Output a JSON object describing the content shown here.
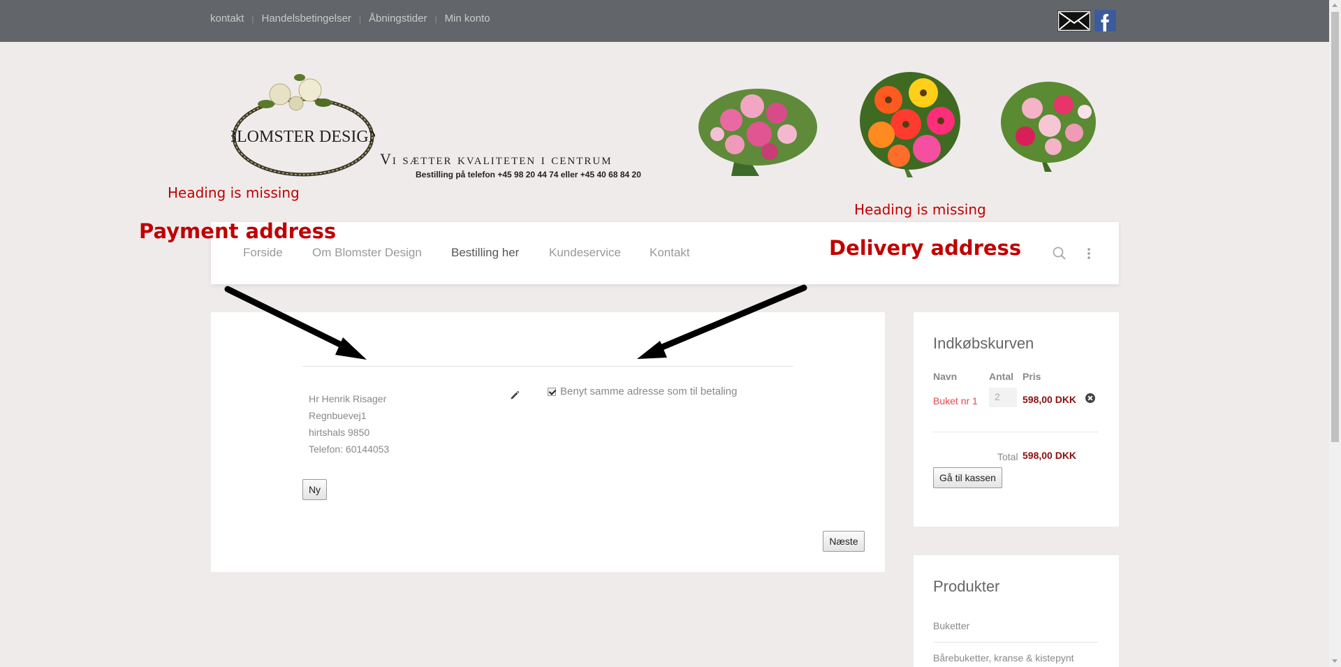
{
  "topbar": {
    "links": [
      "kontakt",
      "Handelsbetingelser",
      "Åbningstider",
      "Min konto"
    ],
    "icons": [
      "mail-icon",
      "facebook-icon"
    ]
  },
  "header": {
    "logo_text": "Blomster Design",
    "tagline": "Vi sætter kvaliteten i centrum",
    "phone": "Bestilling på telefon +45 98 20 44 74 eller +45 40 68 84 20"
  },
  "annotations": {
    "heading_missing_left": "Heading is missing",
    "heading_missing_right": "Heading is missing",
    "payment_address": "Payment address",
    "delivery_address": "Delivery address"
  },
  "nav": {
    "items": [
      "Forside",
      "Om Blomster Design",
      "Bestilling her",
      "Kundeservice",
      "Kontakt"
    ],
    "active": "Bestilling her"
  },
  "address": {
    "name": "Hr Henrik Risager",
    "street": "Regnbuevej1",
    "city": "hirtshals 9850",
    "phone": "Telefon: 60144053"
  },
  "delivery": {
    "same_address_label": "Benyt samme adresse som til betaling",
    "same_address_checked": true
  },
  "buttons": {
    "new": "Ny",
    "next": "Næste",
    "checkout": "Gå til kassen"
  },
  "cart": {
    "title": "Indkøbskurven",
    "headers": [
      "Navn",
      "Antal",
      "Pris"
    ],
    "item_name": "Buket nr 1",
    "item_qty": "2",
    "item_price": "598,00 DKK",
    "total_label": "Total",
    "total_value": "598,00 DKK"
  },
  "products": {
    "title": "Produkter",
    "items": [
      "Buketter",
      "Bårebuketter, kranse & kistepynt"
    ]
  },
  "colors": {
    "topbar": "#62666a",
    "annotation": "#c00000",
    "price": "#8a0e0e",
    "link": "#e0484b"
  }
}
